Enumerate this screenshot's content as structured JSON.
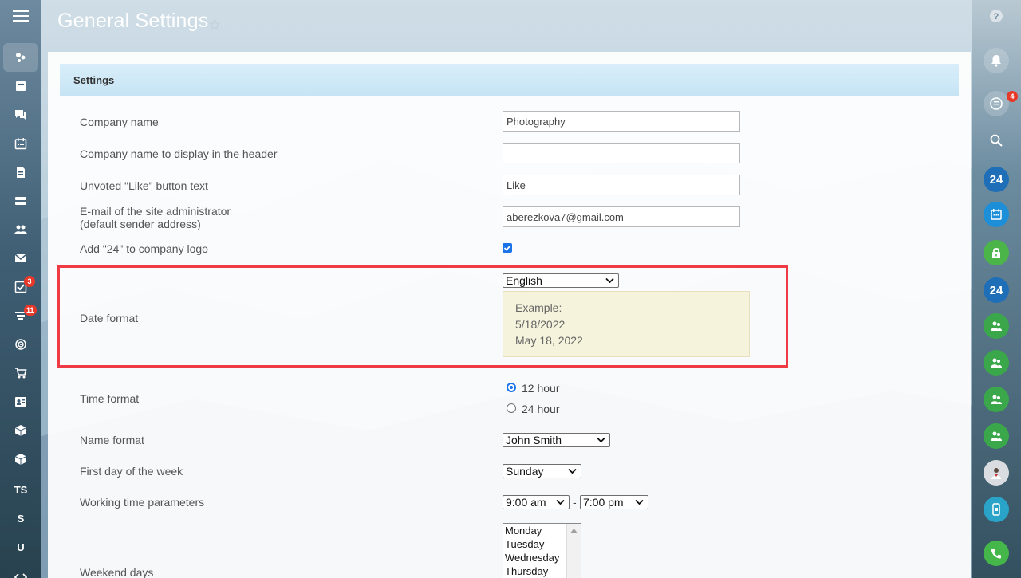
{
  "header": {
    "title": "General Settings"
  },
  "panel": {
    "header_title": "Settings"
  },
  "left_sidebar": {
    "items": [
      {
        "icon": "activity-stream-icon"
      },
      {
        "icon": "tasks-icon"
      },
      {
        "icon": "chat-icon"
      },
      {
        "icon": "calendar-icon"
      },
      {
        "icon": "documents-icon"
      },
      {
        "icon": "drive-icon"
      },
      {
        "icon": "employees-icon"
      },
      {
        "icon": "mail-icon"
      },
      {
        "icon": "task-check-icon",
        "badge": "3"
      },
      {
        "icon": "crm-filter-icon",
        "badge": "11"
      },
      {
        "icon": "target-icon"
      },
      {
        "icon": "cart-icon"
      },
      {
        "icon": "contact-card-icon"
      },
      {
        "icon": "box-icon"
      },
      {
        "icon": "box-icon"
      },
      {
        "text": "TS"
      },
      {
        "text": "S"
      },
      {
        "text": "U"
      }
    ]
  },
  "right_sidebar": {
    "chat_badge": "4",
    "b24_label": "24"
  },
  "form": {
    "company_name": {
      "label": "Company name",
      "value": "Photography"
    },
    "company_name_header": {
      "label": "Company name to display in the header",
      "value": ""
    },
    "like_text": {
      "label": "Unvoted \"Like\" button text",
      "value": "Like"
    },
    "admin_email": {
      "label_line1": "E-mail of the site administrator",
      "label_line2": "(default sender address)",
      "value": "aberezkova7@gmail.com"
    },
    "add24": {
      "label": "Add \"24\" to company logo",
      "checked": true
    },
    "date_format": {
      "label": "Date format",
      "selected": "English",
      "example_title": "Example:",
      "example_short": "5/18/2022",
      "example_long": "May 18, 2022"
    },
    "time_format": {
      "label": "Time format",
      "options": [
        "12 hour",
        "24 hour"
      ],
      "selected": "12 hour"
    },
    "name_format": {
      "label": "Name format",
      "selected": "John Smith"
    },
    "first_day": {
      "label": "First day of the week",
      "selected": "Sunday"
    },
    "working_time": {
      "label": "Working time parameters",
      "start": "9:00 am",
      "separator": "-",
      "end": "7:00 pm"
    },
    "weekend_days": {
      "label": "Weekend days",
      "options": [
        "Monday",
        "Tuesday",
        "Wednesday",
        "Thursday"
      ]
    }
  },
  "colors": {
    "accent": "#1a73e8",
    "highlight": "#ee3b45",
    "example_bg": "#f6f3dc"
  }
}
